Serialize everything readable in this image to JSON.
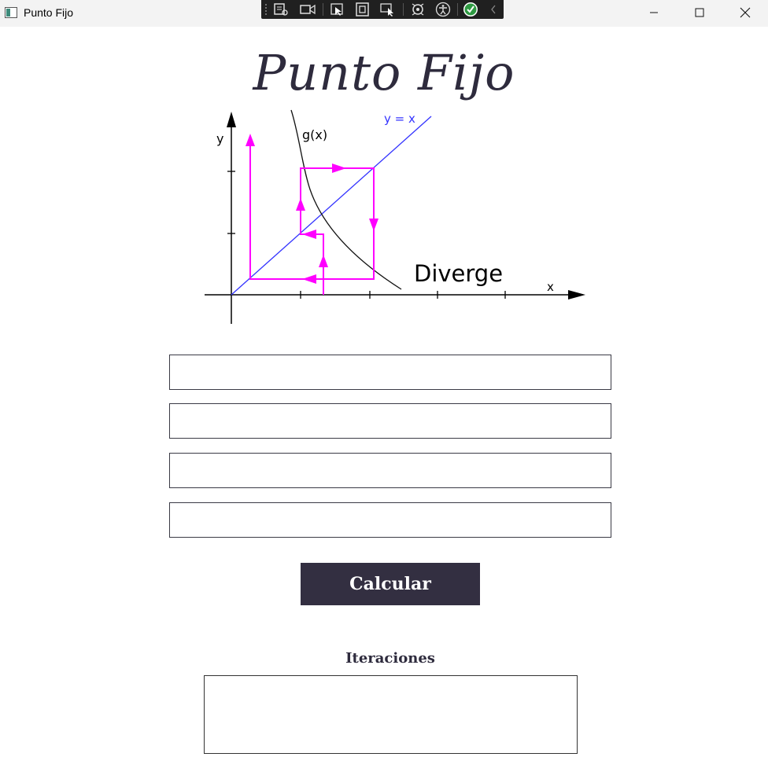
{
  "window": {
    "title": "Punto Fijo"
  },
  "page": {
    "title": "Punto Fijo"
  },
  "diagram": {
    "y_axis_label": "y",
    "x_axis_label": "x",
    "curve_label": "g(x)",
    "line_label": "y = x",
    "annotation": "Diverge",
    "colors": {
      "cobweb": "#ff00ff",
      "identity_line": "#3333ff",
      "curve": "#111111"
    }
  },
  "form": {
    "fields": [
      {
        "value": "",
        "placeholder": ""
      },
      {
        "value": "",
        "placeholder": ""
      },
      {
        "value": "",
        "placeholder": ""
      },
      {
        "value": "",
        "placeholder": ""
      }
    ],
    "button_label": "Calcular"
  },
  "results": {
    "label": "Iteraciones",
    "content": ""
  },
  "icons": {
    "titlebar": [
      "app-window-icon",
      "minimize-icon",
      "maximize-icon",
      "close-icon"
    ],
    "devtools": [
      "live-visual-tree-icon",
      "record-icon",
      "select-element-icon",
      "display-layout-adorners-icon",
      "track-focus-icon",
      "hot-reload-icon",
      "accessibility-icon",
      "binding-failures-check-icon",
      "collapse-chevron-icon"
    ]
  },
  "colors": {
    "button_bg": "#332f41",
    "title_text": "#2e2b3d",
    "toolbar_bg": "#202020"
  }
}
